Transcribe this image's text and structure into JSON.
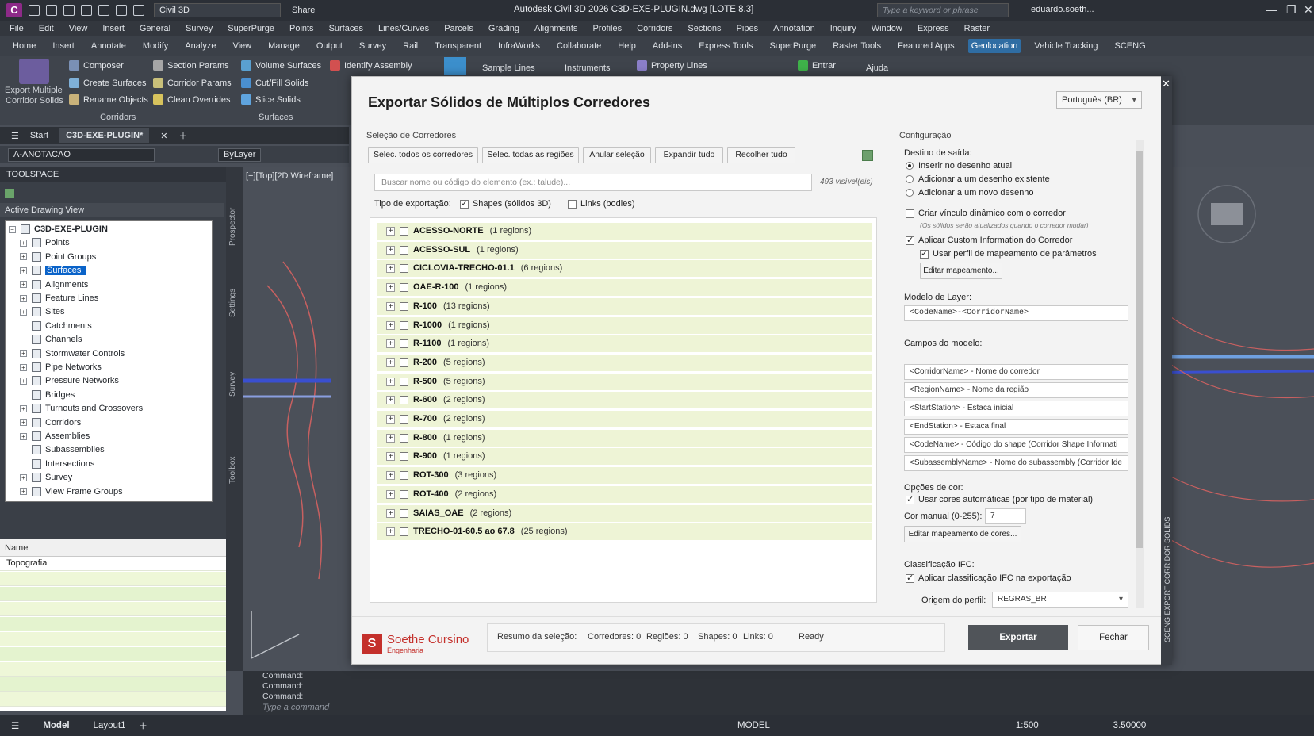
{
  "titlebar": {
    "logo": "C",
    "workspace": "Civil 3D",
    "share": "Share",
    "app_title": "Autodesk Civil 3D 2026   C3D-EXE-PLUGIN.dwg [LOTE 8.3]",
    "search_placeholder": "Type a keyword or phrase",
    "user": "eduardo.soeth..."
  },
  "menubar": [
    "File",
    "Edit",
    "View",
    "Insert",
    "General",
    "Survey",
    "SuperPurge",
    "Points",
    "Surfaces",
    "Lines/Curves",
    "Parcels",
    "Grading",
    "Alignments",
    "Profiles",
    "Corridors",
    "Sections",
    "Pipes",
    "Annotation",
    "Inquiry",
    "Window",
    "Express",
    "Raster"
  ],
  "ribbon_tabs": [
    "Home",
    "Insert",
    "Annotate",
    "Modify",
    "Analyze",
    "View",
    "Manage",
    "Output",
    "Survey",
    "Rail",
    "Transparent",
    "InfraWorks",
    "Collaborate",
    "Help",
    "Add-ins",
    "Express Tools",
    "SuperPurge",
    "Raster Tools",
    "Featured Apps",
    "Geolocation",
    "Vehicle Tracking",
    "SCENG"
  ],
  "ribbon_active": "Geolocation",
  "ribbon": {
    "export_multiple": "Export Multiple",
    "corridor_solids": "Corridor Solids",
    "composer": "Composer",
    "create_surfaces": "Create Surfaces",
    "rename_objects": "Rename Objects",
    "section_params": "Section Params",
    "corridor_params": "Corridor Params",
    "clean_overrides": "Clean Overrides",
    "volume_surfaces": "Volume Surfaces",
    "cutfill_solids": "Cut/Fill Solids",
    "slice_solids": "Slice Solids",
    "identify_assembly": "Identify Assembly",
    "sample_lines": "Sample Lines",
    "instruments": "Instruments",
    "property_lines": "Property Lines",
    "entrar": "Entrar",
    "ajuda": "Ajuda",
    "group_corridors": "Corridors",
    "group_surfaces": "Surfaces"
  },
  "doctabs": {
    "start": "Start",
    "current": "C3D-EXE-PLUGIN*"
  },
  "layerbar": {
    "layer": "A-ANOTACAO",
    "bylayer": "ByLayer"
  },
  "toolspace": {
    "title": "TOOLSPACE",
    "view": "Active Drawing View",
    "root": "C3D-EXE-PLUGIN",
    "items": [
      "Points",
      "Point Groups",
      "Surfaces",
      "Alignments",
      "Feature Lines",
      "Sites",
      "Catchments",
      "Channels",
      "Stormwater Controls",
      "Pipe Networks",
      "Pressure Networks",
      "Bridges",
      "Turnouts and Crossovers",
      "Corridors",
      "Assemblies",
      "Subassemblies",
      "Intersections",
      "Survey",
      "View Frame Groups"
    ],
    "selected": "Surfaces",
    "side_tabs": [
      "Prospector",
      "Settings",
      "Survey",
      "Toolbox"
    ],
    "props_header": "Name",
    "props_row": "Topografia"
  },
  "viewport_label": "[−][Top][2D Wireframe]",
  "command": {
    "lines": [
      "Command:",
      "Command:",
      "Command:"
    ],
    "placeholder": "Type a command"
  },
  "statusbar": {
    "model_tab": "Model",
    "layout_tab": "Layout1",
    "model": "MODEL",
    "scale": "1:500",
    "value": "3.50000"
  },
  "dialog": {
    "title": "Exportar Sólidos de Múltiplos Corredores",
    "language": "Português (BR)",
    "sel_group": "Seleção de Corredores",
    "buttons": [
      "Selec. todos os corredores",
      "Selec. todas as regiões",
      "Anular seleção",
      "Expandir tudo",
      "Recolher tudo"
    ],
    "search_placeholder": "Buscar nome ou código do elemento (ex.: talude)...",
    "visible": "493 visível(eis)",
    "export_type_label": "Tipo de exportação:",
    "shapes": "Shapes (sólidos 3D)",
    "links": "Links (bodies)",
    "corridors": [
      {
        "name": "ACESSO-NORTE",
        "regions": "(1 regions)"
      },
      {
        "name": "ACESSO-SUL",
        "regions": "(1 regions)"
      },
      {
        "name": "CICLOVIA-TRECHO-01.1",
        "regions": "(6 regions)"
      },
      {
        "name": "OAE-R-100",
        "regions": "(1 regions)"
      },
      {
        "name": "R-100",
        "regions": "(13 regions)"
      },
      {
        "name": "R-1000",
        "regions": "(1 regions)"
      },
      {
        "name": "R-1100",
        "regions": "(1 regions)"
      },
      {
        "name": "R-200",
        "regions": "(5 regions)"
      },
      {
        "name": "R-500",
        "regions": "(5 regions)"
      },
      {
        "name": "R-600",
        "regions": "(2 regions)"
      },
      {
        "name": "R-700",
        "regions": "(2 regions)"
      },
      {
        "name": "R-800",
        "regions": "(1 regions)"
      },
      {
        "name": "R-900",
        "regions": "(1 regions)"
      },
      {
        "name": "ROT-300",
        "regions": "(3 regions)"
      },
      {
        "name": "ROT-400",
        "regions": "(2 regions)"
      },
      {
        "name": "SAIAS_OAE",
        "regions": "(2 regions)"
      },
      {
        "name": "TRECHO-01-60.5 ao 67.8",
        "regions": "(25 regions)"
      }
    ],
    "config": {
      "title": "Configuração",
      "dest_label": "Destino de saída:",
      "dest_options": [
        "Inserir no desenho atual",
        "Adicionar a um desenho existente",
        "Adicionar a um novo desenho"
      ],
      "dyn_link": "Criar vínculo dinâmico com o corredor",
      "dyn_note": "(Os sólidos serão atualizados quando o corredor mudar)",
      "custom_info": "Aplicar Custom Information do Corredor",
      "param_profile": "Usar perfil de mapeamento de parâmetros",
      "edit_mapping": "Editar mapeamento...",
      "layer_model_label": "Modelo de Layer:",
      "layer_model": "<CodeName>-<CorridorName>",
      "fields_label": "Campos do modelo:",
      "fields": [
        "<CorridorName> - Nome do corredor",
        "<RegionName> - Nome da região",
        "<StartStation> - Estaca inicial",
        "<EndStation> - Estaca final",
        "<CodeName> - Código do shape (Corridor Shape Informati",
        "<SubassemblyName> - Nome do subassembly (Corridor Ide"
      ],
      "color_label": "Opções de cor:",
      "auto_colors": "Usar cores automáticas (por tipo de material)",
      "manual_color_label": "Cor manual (0-255):",
      "manual_color": "7",
      "edit_colors": "Editar mapeamento de cores...",
      "ifc_label": "Classificação IFC:",
      "ifc_apply": "Aplicar classificação IFC na exportação",
      "origin_label": "Origem do perfil:",
      "origin": "REGRAS_BR"
    },
    "brand": {
      "name": "Soethe Cursino",
      "sub": "Engenharia"
    },
    "summary": {
      "label": "Resumo da seleção:",
      "corridors": "Corredores: 0",
      "regions": "Regiões: 0",
      "shapes": "Shapes: 0",
      "links": "Links: 0",
      "status": "Ready"
    },
    "export": "Exportar",
    "close": "Fechar",
    "side_title": "SCENG EXPORT CORRIDOR SOLIDS"
  },
  "colors": {
    "accent": "#2f6da3",
    "row_bg": "#eef4d6",
    "selected": "#0a63c9",
    "export_btn": "#505459"
  }
}
